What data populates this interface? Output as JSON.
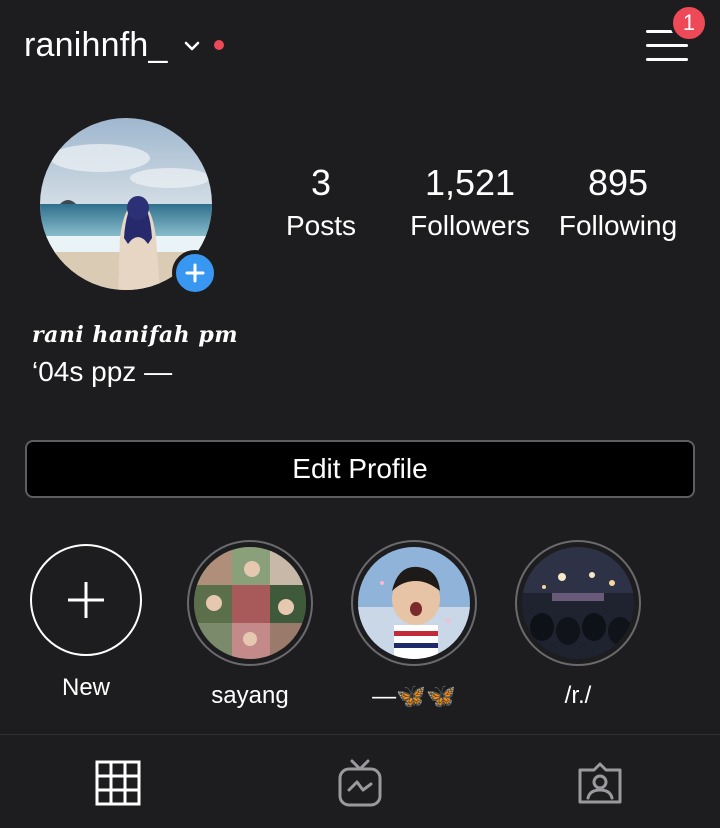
{
  "header": {
    "username": "ranihnfh_",
    "notification_count": "1",
    "live_dot_color": "#ed4956"
  },
  "profile": {
    "display_name": "rani hanifah pm",
    "bio": "‘04s ppz —",
    "accent_color": "#3897f0"
  },
  "stats": [
    {
      "value": "3",
      "label": "Posts"
    },
    {
      "value": "1,521",
      "label": "Followers"
    },
    {
      "value": "895",
      "label": "Following"
    }
  ],
  "edit_profile_label": "Edit Profile",
  "highlights": [
    {
      "label": "New",
      "icon": "plus-icon"
    },
    {
      "label": "sayang"
    },
    {
      "label": "—🦋🦋"
    },
    {
      "label": "/r./"
    }
  ],
  "tabs": [
    {
      "icon": "grid-icon"
    },
    {
      "icon": "igtv-icon"
    },
    {
      "icon": "tagged-icon"
    }
  ]
}
